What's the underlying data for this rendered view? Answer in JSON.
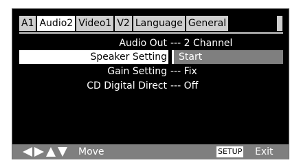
{
  "tabs": [
    {
      "label": "A1",
      "active": false
    },
    {
      "label": "Audio2",
      "active": true
    },
    {
      "label": "Video1",
      "active": false
    },
    {
      "label": "V2",
      "active": false
    },
    {
      "label": "Language",
      "active": false
    },
    {
      "label": "General",
      "active": false
    }
  ],
  "settings": [
    {
      "label": "Audio Out",
      "value": "--- 2 Channel",
      "selected": false
    },
    {
      "label": "Speaker Setting",
      "value": "Start",
      "selected": true
    },
    {
      "label": "Gain Setting",
      "value": "--- Fix",
      "selected": false
    },
    {
      "label": "CD Digital Direct",
      "value": "--- Off",
      "selected": false
    }
  ],
  "footer": {
    "nav_icons": [
      "left-arrow-icon",
      "right-arrow-icon",
      "up-arrow-icon",
      "down-arrow-icon"
    ],
    "move_label": "Move",
    "setup_key": "SETUP",
    "exit_label": "Exit"
  },
  "colors": {
    "background": "#000000",
    "tab_inactive": "#cfcfcf",
    "tab_active": "#ffffff",
    "selected_value_bg": "#7f7f7f",
    "footer_bg": "#7f7f7f"
  }
}
